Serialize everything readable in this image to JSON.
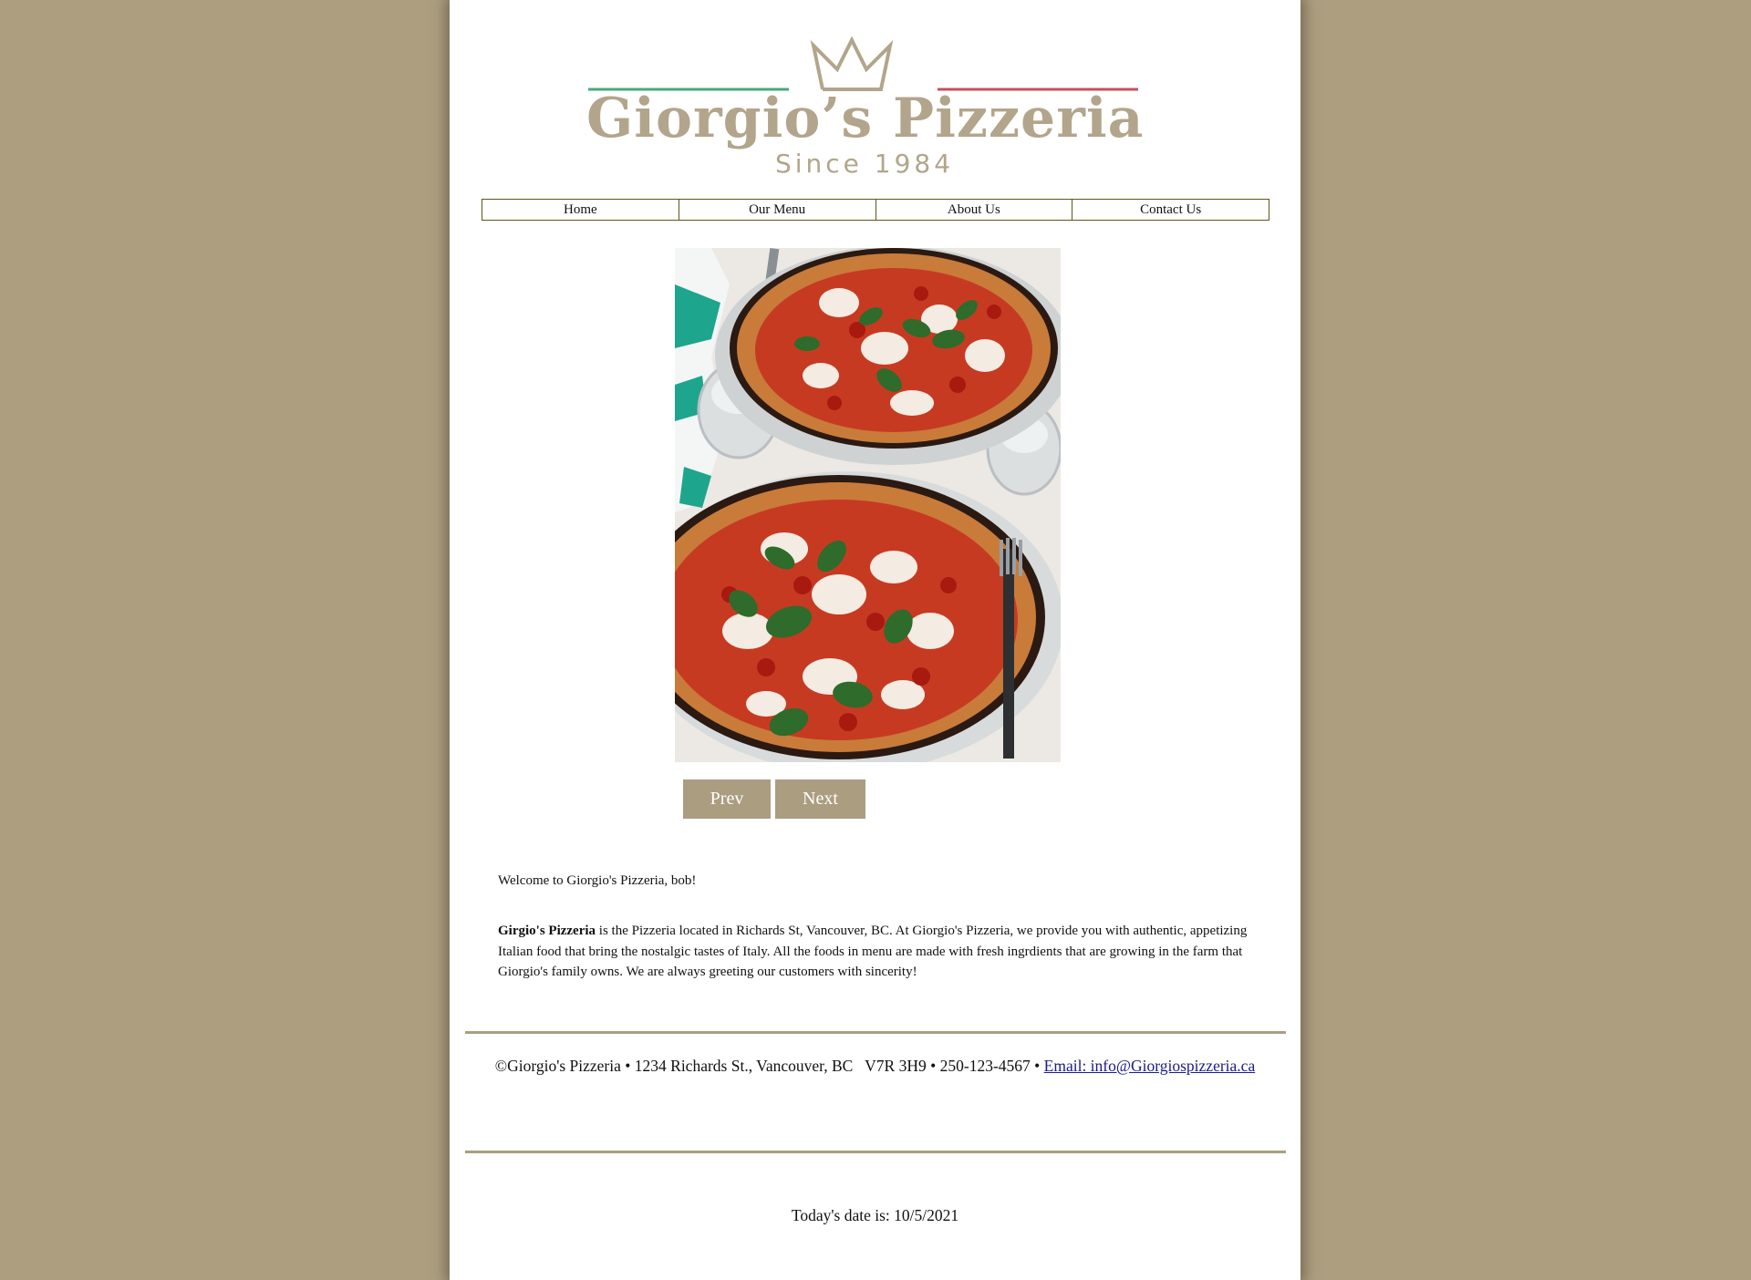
{
  "logo": {
    "name": "Giorgio’s Pizzeria",
    "tagline": "Since 1984",
    "colors": {
      "gold": "#b2a58b",
      "green": "#4aa87b",
      "red": "#c35060"
    }
  },
  "nav": {
    "items": [
      {
        "label": "Home"
      },
      {
        "label": "Our Menu"
      },
      {
        "label": "About Us"
      },
      {
        "label": "Contact Us"
      }
    ]
  },
  "slideshow": {
    "image": "pizza-photo",
    "prev_label": "Prev",
    "next_label": "Next"
  },
  "content": {
    "welcome": "Welcome to Giorgio's Pizzeria, bob!",
    "about_bold": "Girgio's Pizzeria",
    "about_text": " is the Pizzeria located in Richards St, Vancouver, BC. At Giorgio's Pizzeria, we provide you with authentic, appetizing Italian food that bring the nostalgic tastes of Italy. All the foods in menu are made with fresh ingrdients that are growing in the farm that Giorgio's family owns. We are always greeting our customers with sincerity!"
  },
  "footer": {
    "text": "©Giorgio's Pizzeria • 1234 Richards St., Vancouver, BC   V7R 3H9 • 250-123-4567 • ",
    "email_label": "Email: info@Giorgiospizzeria.ca"
  },
  "date": {
    "text": "Today's date is: 10/5/2021"
  },
  "colors": {
    "background": "#ad9e80",
    "accent": "#ab9d80",
    "nav_border": "#5f5518",
    "link": "#1a1a8c"
  }
}
